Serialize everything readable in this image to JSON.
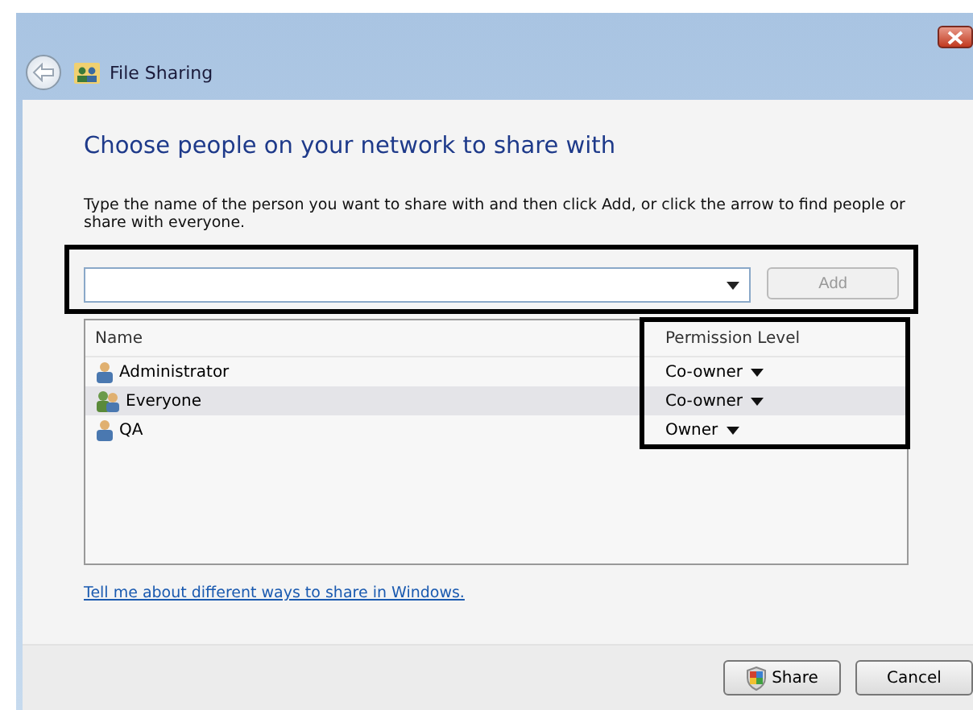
{
  "window": {
    "title": "File Sharing"
  },
  "heading": "Choose people on your network to share with",
  "instructions": "Type the name of the person you want to share with and then click Add, or click the arrow to find people or share with everyone.",
  "add_button": {
    "label": "Add",
    "disabled": true
  },
  "table": {
    "columns": [
      "Name",
      "Permission Level"
    ],
    "rows": [
      {
        "name": "Administrator",
        "kind": "user",
        "permission": "Co-owner",
        "selected": false
      },
      {
        "name": "Everyone",
        "kind": "group",
        "permission": "Co-owner",
        "selected": true
      },
      {
        "name": "QA",
        "kind": "user",
        "permission": "Owner",
        "selected": false
      }
    ]
  },
  "help_link": "Tell me about different ways to share in Windows.",
  "buttons": [
    {
      "label": "Share",
      "kind": "shield"
    },
    {
      "label": "Cancel",
      "kind": "plain"
    }
  ]
}
